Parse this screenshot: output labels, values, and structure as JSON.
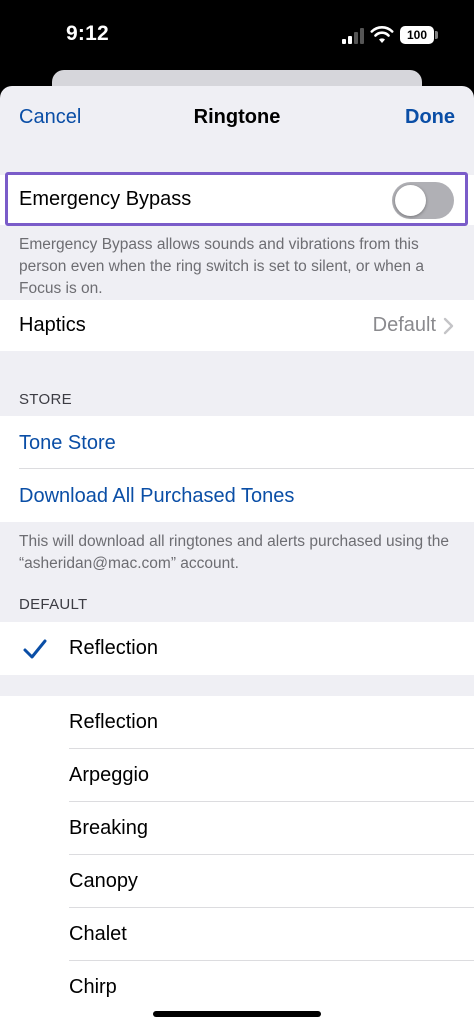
{
  "status_bar": {
    "time": "9:12",
    "battery": "100"
  },
  "nav": {
    "cancel": "Cancel",
    "title": "Ringtone",
    "done": "Done"
  },
  "emergency_bypass": {
    "label": "Emergency Bypass",
    "enabled": false,
    "description": "Emergency Bypass allows sounds and vibrations from this person even when the ring switch is set to silent, or when a Focus is on."
  },
  "haptics": {
    "label": "Haptics",
    "value": "Default"
  },
  "store": {
    "header": "STORE",
    "tone_store": "Tone Store",
    "download_all": "Download All Purchased Tones",
    "footnote": "This will download all ringtones and alerts purchased using the “asheridan@mac.com” account."
  },
  "default_section": {
    "header": "DEFAULT",
    "selected": "Reflection"
  },
  "ringtones": [
    "Reflection",
    "Arpeggio",
    "Breaking",
    "Canopy",
    "Chalet",
    "Chirp"
  ],
  "colors": {
    "accent": "#0a4ea6",
    "highlight": "#7a5cc9",
    "toggle_off": "#b0b0b5"
  }
}
